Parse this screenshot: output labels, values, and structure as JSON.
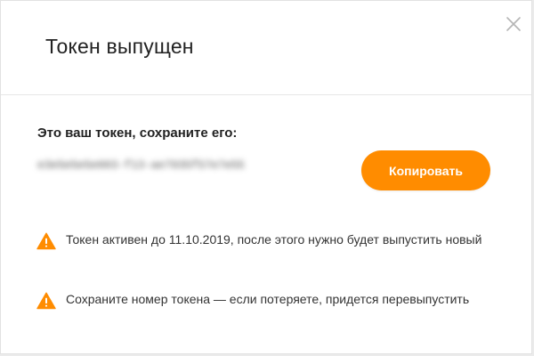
{
  "dialog": {
    "title": "Токен выпущен",
    "close_icon": "close-icon"
  },
  "content": {
    "subtitle": "Это ваш токен, сохраните его:",
    "token_value": "e3e5e5e5e603-f13-ae7935f57e7e55",
    "copy_button": "Копировать"
  },
  "notices": [
    {
      "icon": "warning-icon",
      "text": "Токен активен до 11.10.2019, после этого нужно будет выпустить новый"
    },
    {
      "icon": "warning-icon",
      "text": "Сохраните номер токена — если потеряете, придется перевыпустить"
    }
  ],
  "colors": {
    "accent": "#ff8c00",
    "warning": "#ff8c00",
    "text": "#222222"
  }
}
